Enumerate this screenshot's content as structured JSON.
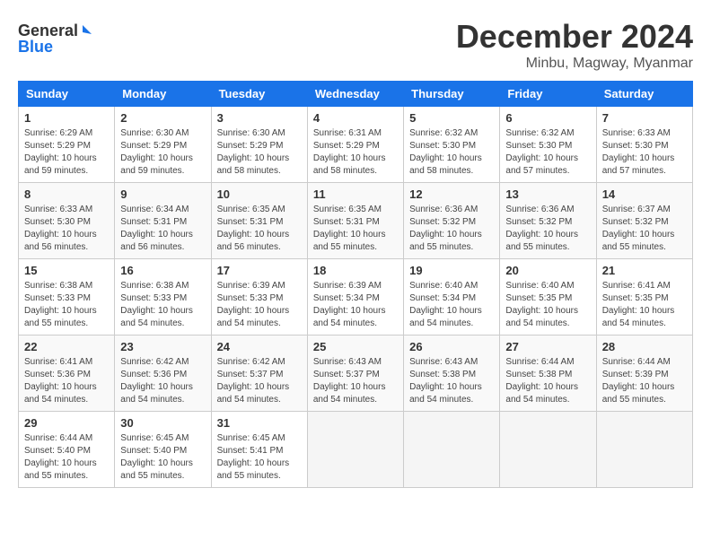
{
  "logo": {
    "line1": "General",
    "line2": "Blue"
  },
  "title": "December 2024",
  "subtitle": "Minbu, Magway, Myanmar",
  "weekdays": [
    "Sunday",
    "Monday",
    "Tuesday",
    "Wednesday",
    "Thursday",
    "Friday",
    "Saturday"
  ],
  "weeks": [
    [
      {
        "day": "1",
        "sunrise": "6:29 AM",
        "sunset": "5:29 PM",
        "daylight": "10 hours and 59 minutes."
      },
      {
        "day": "2",
        "sunrise": "6:30 AM",
        "sunset": "5:29 PM",
        "daylight": "10 hours and 59 minutes."
      },
      {
        "day": "3",
        "sunrise": "6:30 AM",
        "sunset": "5:29 PM",
        "daylight": "10 hours and 58 minutes."
      },
      {
        "day": "4",
        "sunrise": "6:31 AM",
        "sunset": "5:29 PM",
        "daylight": "10 hours and 58 minutes."
      },
      {
        "day": "5",
        "sunrise": "6:32 AM",
        "sunset": "5:30 PM",
        "daylight": "10 hours and 58 minutes."
      },
      {
        "day": "6",
        "sunrise": "6:32 AM",
        "sunset": "5:30 PM",
        "daylight": "10 hours and 57 minutes."
      },
      {
        "day": "7",
        "sunrise": "6:33 AM",
        "sunset": "5:30 PM",
        "daylight": "10 hours and 57 minutes."
      }
    ],
    [
      {
        "day": "8",
        "sunrise": "6:33 AM",
        "sunset": "5:30 PM",
        "daylight": "10 hours and 56 minutes."
      },
      {
        "day": "9",
        "sunrise": "6:34 AM",
        "sunset": "5:31 PM",
        "daylight": "10 hours and 56 minutes."
      },
      {
        "day": "10",
        "sunrise": "6:35 AM",
        "sunset": "5:31 PM",
        "daylight": "10 hours and 56 minutes."
      },
      {
        "day": "11",
        "sunrise": "6:35 AM",
        "sunset": "5:31 PM",
        "daylight": "10 hours and 55 minutes."
      },
      {
        "day": "12",
        "sunrise": "6:36 AM",
        "sunset": "5:32 PM",
        "daylight": "10 hours and 55 minutes."
      },
      {
        "day": "13",
        "sunrise": "6:36 AM",
        "sunset": "5:32 PM",
        "daylight": "10 hours and 55 minutes."
      },
      {
        "day": "14",
        "sunrise": "6:37 AM",
        "sunset": "5:32 PM",
        "daylight": "10 hours and 55 minutes."
      }
    ],
    [
      {
        "day": "15",
        "sunrise": "6:38 AM",
        "sunset": "5:33 PM",
        "daylight": "10 hours and 55 minutes."
      },
      {
        "day": "16",
        "sunrise": "6:38 AM",
        "sunset": "5:33 PM",
        "daylight": "10 hours and 54 minutes."
      },
      {
        "day": "17",
        "sunrise": "6:39 AM",
        "sunset": "5:33 PM",
        "daylight": "10 hours and 54 minutes."
      },
      {
        "day": "18",
        "sunrise": "6:39 AM",
        "sunset": "5:34 PM",
        "daylight": "10 hours and 54 minutes."
      },
      {
        "day": "19",
        "sunrise": "6:40 AM",
        "sunset": "5:34 PM",
        "daylight": "10 hours and 54 minutes."
      },
      {
        "day": "20",
        "sunrise": "6:40 AM",
        "sunset": "5:35 PM",
        "daylight": "10 hours and 54 minutes."
      },
      {
        "day": "21",
        "sunrise": "6:41 AM",
        "sunset": "5:35 PM",
        "daylight": "10 hours and 54 minutes."
      }
    ],
    [
      {
        "day": "22",
        "sunrise": "6:41 AM",
        "sunset": "5:36 PM",
        "daylight": "10 hours and 54 minutes."
      },
      {
        "day": "23",
        "sunrise": "6:42 AM",
        "sunset": "5:36 PM",
        "daylight": "10 hours and 54 minutes."
      },
      {
        "day": "24",
        "sunrise": "6:42 AM",
        "sunset": "5:37 PM",
        "daylight": "10 hours and 54 minutes."
      },
      {
        "day": "25",
        "sunrise": "6:43 AM",
        "sunset": "5:37 PM",
        "daylight": "10 hours and 54 minutes."
      },
      {
        "day": "26",
        "sunrise": "6:43 AM",
        "sunset": "5:38 PM",
        "daylight": "10 hours and 54 minutes."
      },
      {
        "day": "27",
        "sunrise": "6:44 AM",
        "sunset": "5:38 PM",
        "daylight": "10 hours and 54 minutes."
      },
      {
        "day": "28",
        "sunrise": "6:44 AM",
        "sunset": "5:39 PM",
        "daylight": "10 hours and 55 minutes."
      }
    ],
    [
      {
        "day": "29",
        "sunrise": "6:44 AM",
        "sunset": "5:40 PM",
        "daylight": "10 hours and 55 minutes."
      },
      {
        "day": "30",
        "sunrise": "6:45 AM",
        "sunset": "5:40 PM",
        "daylight": "10 hours and 55 minutes."
      },
      {
        "day": "31",
        "sunrise": "6:45 AM",
        "sunset": "5:41 PM",
        "daylight": "10 hours and 55 minutes."
      },
      null,
      null,
      null,
      null
    ]
  ],
  "labels": {
    "sunrise": "Sunrise:",
    "sunset": "Sunset:",
    "daylight": "Daylight:"
  }
}
